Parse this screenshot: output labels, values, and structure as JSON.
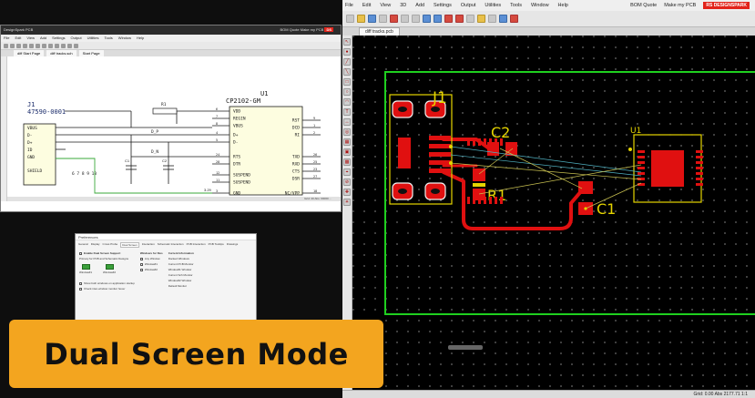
{
  "banner": {
    "text": "Dual Screen Mode"
  },
  "left_window": {
    "title": "DesignSpark PCB",
    "title_right": "BOM Quote  Make my PCB",
    "logo": "DS",
    "menu": [
      "File",
      "Edit",
      "View",
      "Add",
      "Settings",
      "Output",
      "Utilities",
      "Tools",
      "Window",
      "Help"
    ],
    "tabs": [
      "diff Start Page",
      "diff tracks.sch",
      "Start Page"
    ],
    "status": "Grid: 20 Abs: 00000  ...",
    "schematic": {
      "j1_ref": "J1",
      "j1_value": "47590-0001",
      "j1_pins": [
        "VBUS",
        "D-",
        "D+",
        "ID",
        "GND",
        "SHIELD"
      ],
      "j1_pin_numbers": "6 7 8 9 10",
      "r1_ref": "R1",
      "c1_ref": "C1",
      "c2_ref": "C2",
      "u1_ref": "U1",
      "u1_value": "CP2102-GM",
      "u1_left_pins": [
        "VDD",
        "REGIN",
        "VBUS",
        "D+",
        "D-",
        "RTS",
        "DTR",
        "SUSPEND",
        "SUSPEND",
        "GND"
      ],
      "u1_left_nums": [
        "6",
        "7",
        "8",
        "4",
        "5",
        "24",
        "28",
        "12",
        "11",
        "3"
      ],
      "u1_right_pins": [
        "RST",
        "DCD",
        "RI",
        "TXD",
        "RXD",
        "CTS",
        "DSR",
        "NC/VPP"
      ],
      "u1_right_nums": [
        "9",
        "1",
        "2",
        "26",
        "25",
        "23",
        "27",
        "18"
      ],
      "net_dp": "D_P",
      "net_dn": "D_N",
      "gnd_pins": "3.29"
    }
  },
  "right_window": {
    "menu": [
      "File",
      "Edit",
      "View",
      "3D",
      "Add",
      "Settings",
      "Output",
      "Utilities",
      "Tools",
      "Window",
      "Help"
    ],
    "menu_right": [
      "BOM Quote",
      "Make my PCB"
    ],
    "logo": "RS DESIGNSPARK",
    "tab": "diff tracks.pcb",
    "status": "Grid: 0.00 Abs  2177.71  1:1",
    "pcb": {
      "j1": "J1",
      "c2": "C2",
      "r1": "R1",
      "c1": "C1",
      "u1": "U1"
    }
  },
  "dialog": {
    "title": "Preferences",
    "tabs": [
      "General",
      "Display",
      "Cross Probe",
      "Dual Screen",
      "Interaction",
      "Schematic Interaction",
      "PCB Interaction",
      "PCB Tooltips",
      "Drawings"
    ],
    "selected_tab": "Dual Screen",
    "col1_header": "Enable Dual Screen Support",
    "col1_sub": "Primary for PCB and Schematic Designs",
    "col1_items": [
      "Window#1",
      "Window#2"
    ],
    "col2_header": "Windows for files",
    "col2_items": [
      "Any Window",
      "Window#1",
      "Window#2"
    ],
    "col3_header": "Current Information",
    "col3_items": [
      "Docked Windows",
      "Current PCB Monitor",
      "Window#1 Window",
      "Current Sch Monitor",
      "Window#2 Window",
      "Default Monitor"
    ],
    "checks": [
      "Show both windows on application startup",
      "Check inter-window monitor hover"
    ]
  },
  "colors": {
    "banner": "#f3a51f",
    "pcb_copper": "#e01010",
    "pcb_silk": "#e5d400",
    "board_outline": "#1fd01f",
    "schematic_wire": "#1a1a1a",
    "green_wire": "#3aa83a"
  }
}
